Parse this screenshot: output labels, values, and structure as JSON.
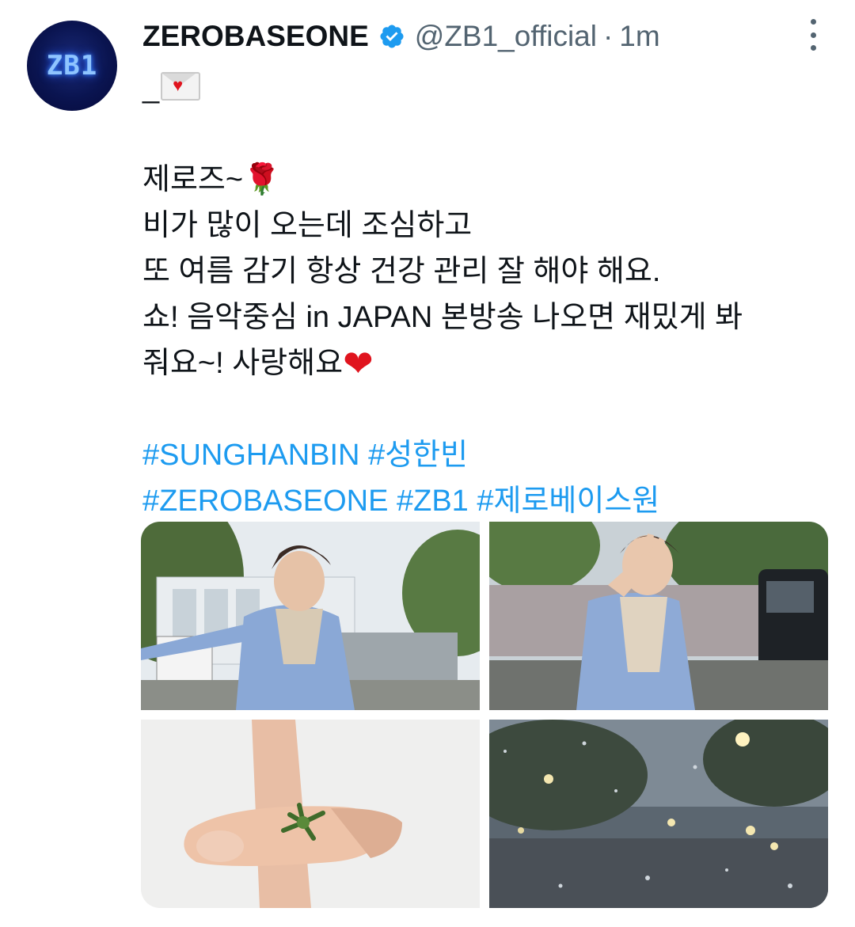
{
  "author": {
    "display_name": "ZEROBASEONE",
    "handle": "@ZB1_official",
    "separator": "·",
    "time": "1m",
    "avatar_text": "ZB1",
    "verified": true
  },
  "tweet": {
    "line1_prefix": "_",
    "line3": "제로즈~",
    "line4": "비가 많이 오는데 조심하고",
    "line5": "또 여름 감기 항상 건강 관리 잘 해야 해요.",
    "line6": "쇼! 음악중심 in JAPAN 본방송 나오면 재밌게 봐",
    "line7": "줘요~! 사랑해요",
    "hashtags_line1": [
      "#SUNGHANBIN",
      "#성한빈"
    ],
    "hashtags_line2": [
      "#ZEROBASEONE",
      "#ZB1",
      "#제로베이스원"
    ]
  },
  "media": {
    "count": 4,
    "items": [
      {
        "icon": "photo-outdoor-pose"
      },
      {
        "icon": "photo-peace-sign"
      },
      {
        "icon": "photo-finger-plant"
      },
      {
        "icon": "photo-rainy-window"
      }
    ]
  },
  "colors": {
    "accent": "#1d9bf0",
    "text": "#0f1419",
    "secondary": "#536471"
  }
}
